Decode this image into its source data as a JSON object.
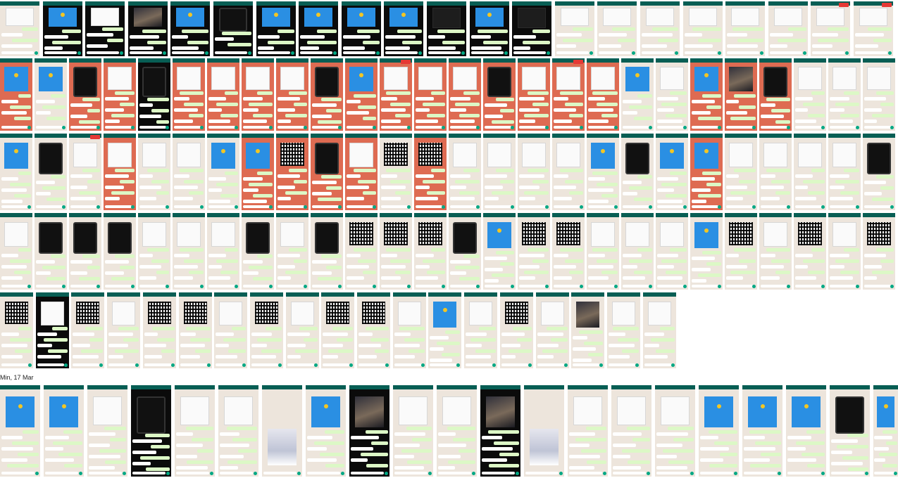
{
  "section_heading": "Min, 17 Mar",
  "colors": {
    "chat_wallpaper": "#ede5dc",
    "chat_wallpaper_orange": "#de6b52",
    "header_green": "#075e54",
    "bubble_out": "#dcf8c6",
    "bubble_in": "#ffffff",
    "accent_blue": "#2a8fe3",
    "coin_yellow": "#f3c623",
    "badge_red": "#e53935"
  },
  "icons": [
    "send-icon",
    "coin-icon",
    "badge-icon"
  ],
  "rows": [
    {
      "thumbs": [
        "doc",
        "dark-blue",
        "dark-doc",
        "dark-photo",
        "dark-blue",
        "dark-dev",
        "dark-blue",
        "dark-blue",
        "dark-blue",
        "dark-blue",
        "dark",
        "dark-blue",
        "dark",
        "doc",
        "doc",
        "doc",
        "doc",
        "doc",
        "doc",
        "doc-badge",
        "doc-badge"
      ]
    },
    {
      "thumbs": [
        "orange-blue",
        "blue",
        "orange-dev",
        "orange-doc",
        "dark-dev",
        "orange-doc",
        "orange-doc",
        "orange-doc",
        "orange-doc",
        "orange-dev",
        "orange-blue",
        "orange-badge",
        "orange-doc",
        "orange-doc",
        "orange-dev",
        "orange-doc",
        "orange-badge",
        "orange-doc",
        "blue",
        "doc",
        "orange-blue",
        "orange-photo",
        "orange-dev",
        "doc",
        "doc",
        "doc"
      ]
    },
    {
      "thumbs": [
        "blue",
        "dev",
        "doc-badge",
        "orange-doc",
        "doc",
        "doc",
        "blue",
        "orange-blue",
        "orange-qr",
        "orange-dev",
        "orange-doc",
        "qr",
        "orange-qr",
        "doc",
        "doc",
        "doc",
        "doc",
        "blue",
        "dev",
        "blue",
        "orange-blue",
        "doc",
        "doc",
        "doc",
        "doc",
        "dev"
      ]
    },
    {
      "thumbs": [
        "doc",
        "dev",
        "dev",
        "dev",
        "doc",
        "doc",
        "doc",
        "dev",
        "doc",
        "dev",
        "qr",
        "qr",
        "qr",
        "dev",
        "blue",
        "qr",
        "qr",
        "doc",
        "doc",
        "doc",
        "blue",
        "qr",
        "doc",
        "qr",
        "doc",
        "qr"
      ]
    },
    {
      "thumbs": [
        "qr",
        "dark-doc",
        "qr",
        "doc",
        "qr",
        "qr",
        "doc",
        "qr",
        "doc",
        "qr",
        "qr",
        "doc",
        "blue",
        "doc",
        "qr",
        "doc",
        "photo",
        "doc",
        "doc"
      ]
    },
    {
      "thumbs": [
        "blue",
        "blue",
        "doc",
        "dark-dev",
        "doc",
        "doc",
        "doc-figure",
        "blue",
        "dark-photo",
        "doc",
        "doc",
        "dark-photo",
        "doc-figure",
        "doc",
        "doc",
        "doc",
        "blue",
        "blue",
        "blue",
        "dev",
        "blue"
      ]
    }
  ]
}
